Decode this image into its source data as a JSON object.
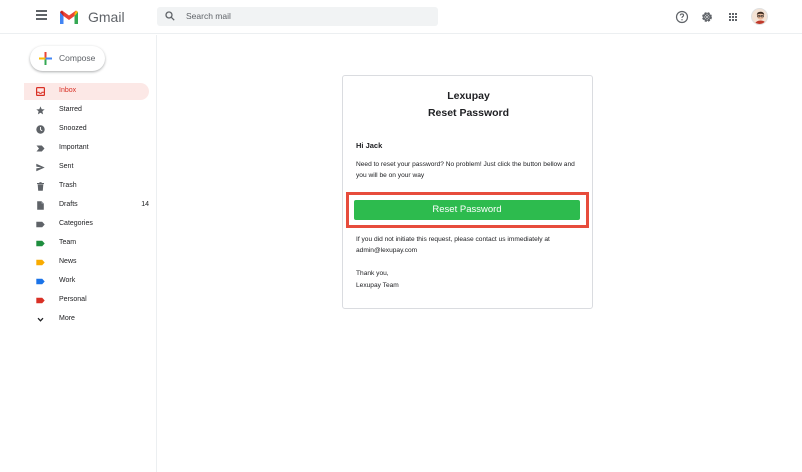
{
  "header": {
    "app_name": "Gmail",
    "search_placeholder": "Search mail"
  },
  "sidebar": {
    "compose_label": "Compose",
    "items": [
      {
        "label": "Inbox",
        "icon": "inbox-icon",
        "active": true
      },
      {
        "label": "Starred",
        "icon": "star-icon"
      },
      {
        "label": "Snoozed",
        "icon": "clock-icon"
      },
      {
        "label": "Important",
        "icon": "important-icon"
      },
      {
        "label": "Sent",
        "icon": "send-icon"
      },
      {
        "label": "Trash",
        "icon": "trash-icon"
      },
      {
        "label": "Drafts",
        "icon": "draft-icon",
        "count": "14"
      },
      {
        "label": "Categories",
        "icon": "label-icon"
      },
      {
        "label": "Team",
        "icon": "label-icon",
        "color": "#1e8e3e"
      },
      {
        "label": "News",
        "icon": "label-icon",
        "color": "#f9ab00"
      },
      {
        "label": "Work",
        "icon": "label-icon",
        "color": "#1a73e8"
      },
      {
        "label": "Personal",
        "icon": "label-icon",
        "color": "#d93025"
      },
      {
        "label": "More",
        "icon": "chevron-down-icon"
      }
    ]
  },
  "email": {
    "brand": "Lexupay",
    "subject": "Reset Password",
    "greeting": "Hi Jack",
    "body": "Need to reset your password? No problem! Just click the button bellow and you will be on your way",
    "button_label": "Reset Password",
    "note": "If you did not initiate this request, please contact us immediately at admin@lexupay.com",
    "signoff_line1": "Thank you,",
    "signoff_line2": "Lexupay Team"
  },
  "colors": {
    "button": "#2dbb4e",
    "highlight": "#e74c3c",
    "active_bg": "#fce8e6",
    "active_text": "#d93025"
  }
}
